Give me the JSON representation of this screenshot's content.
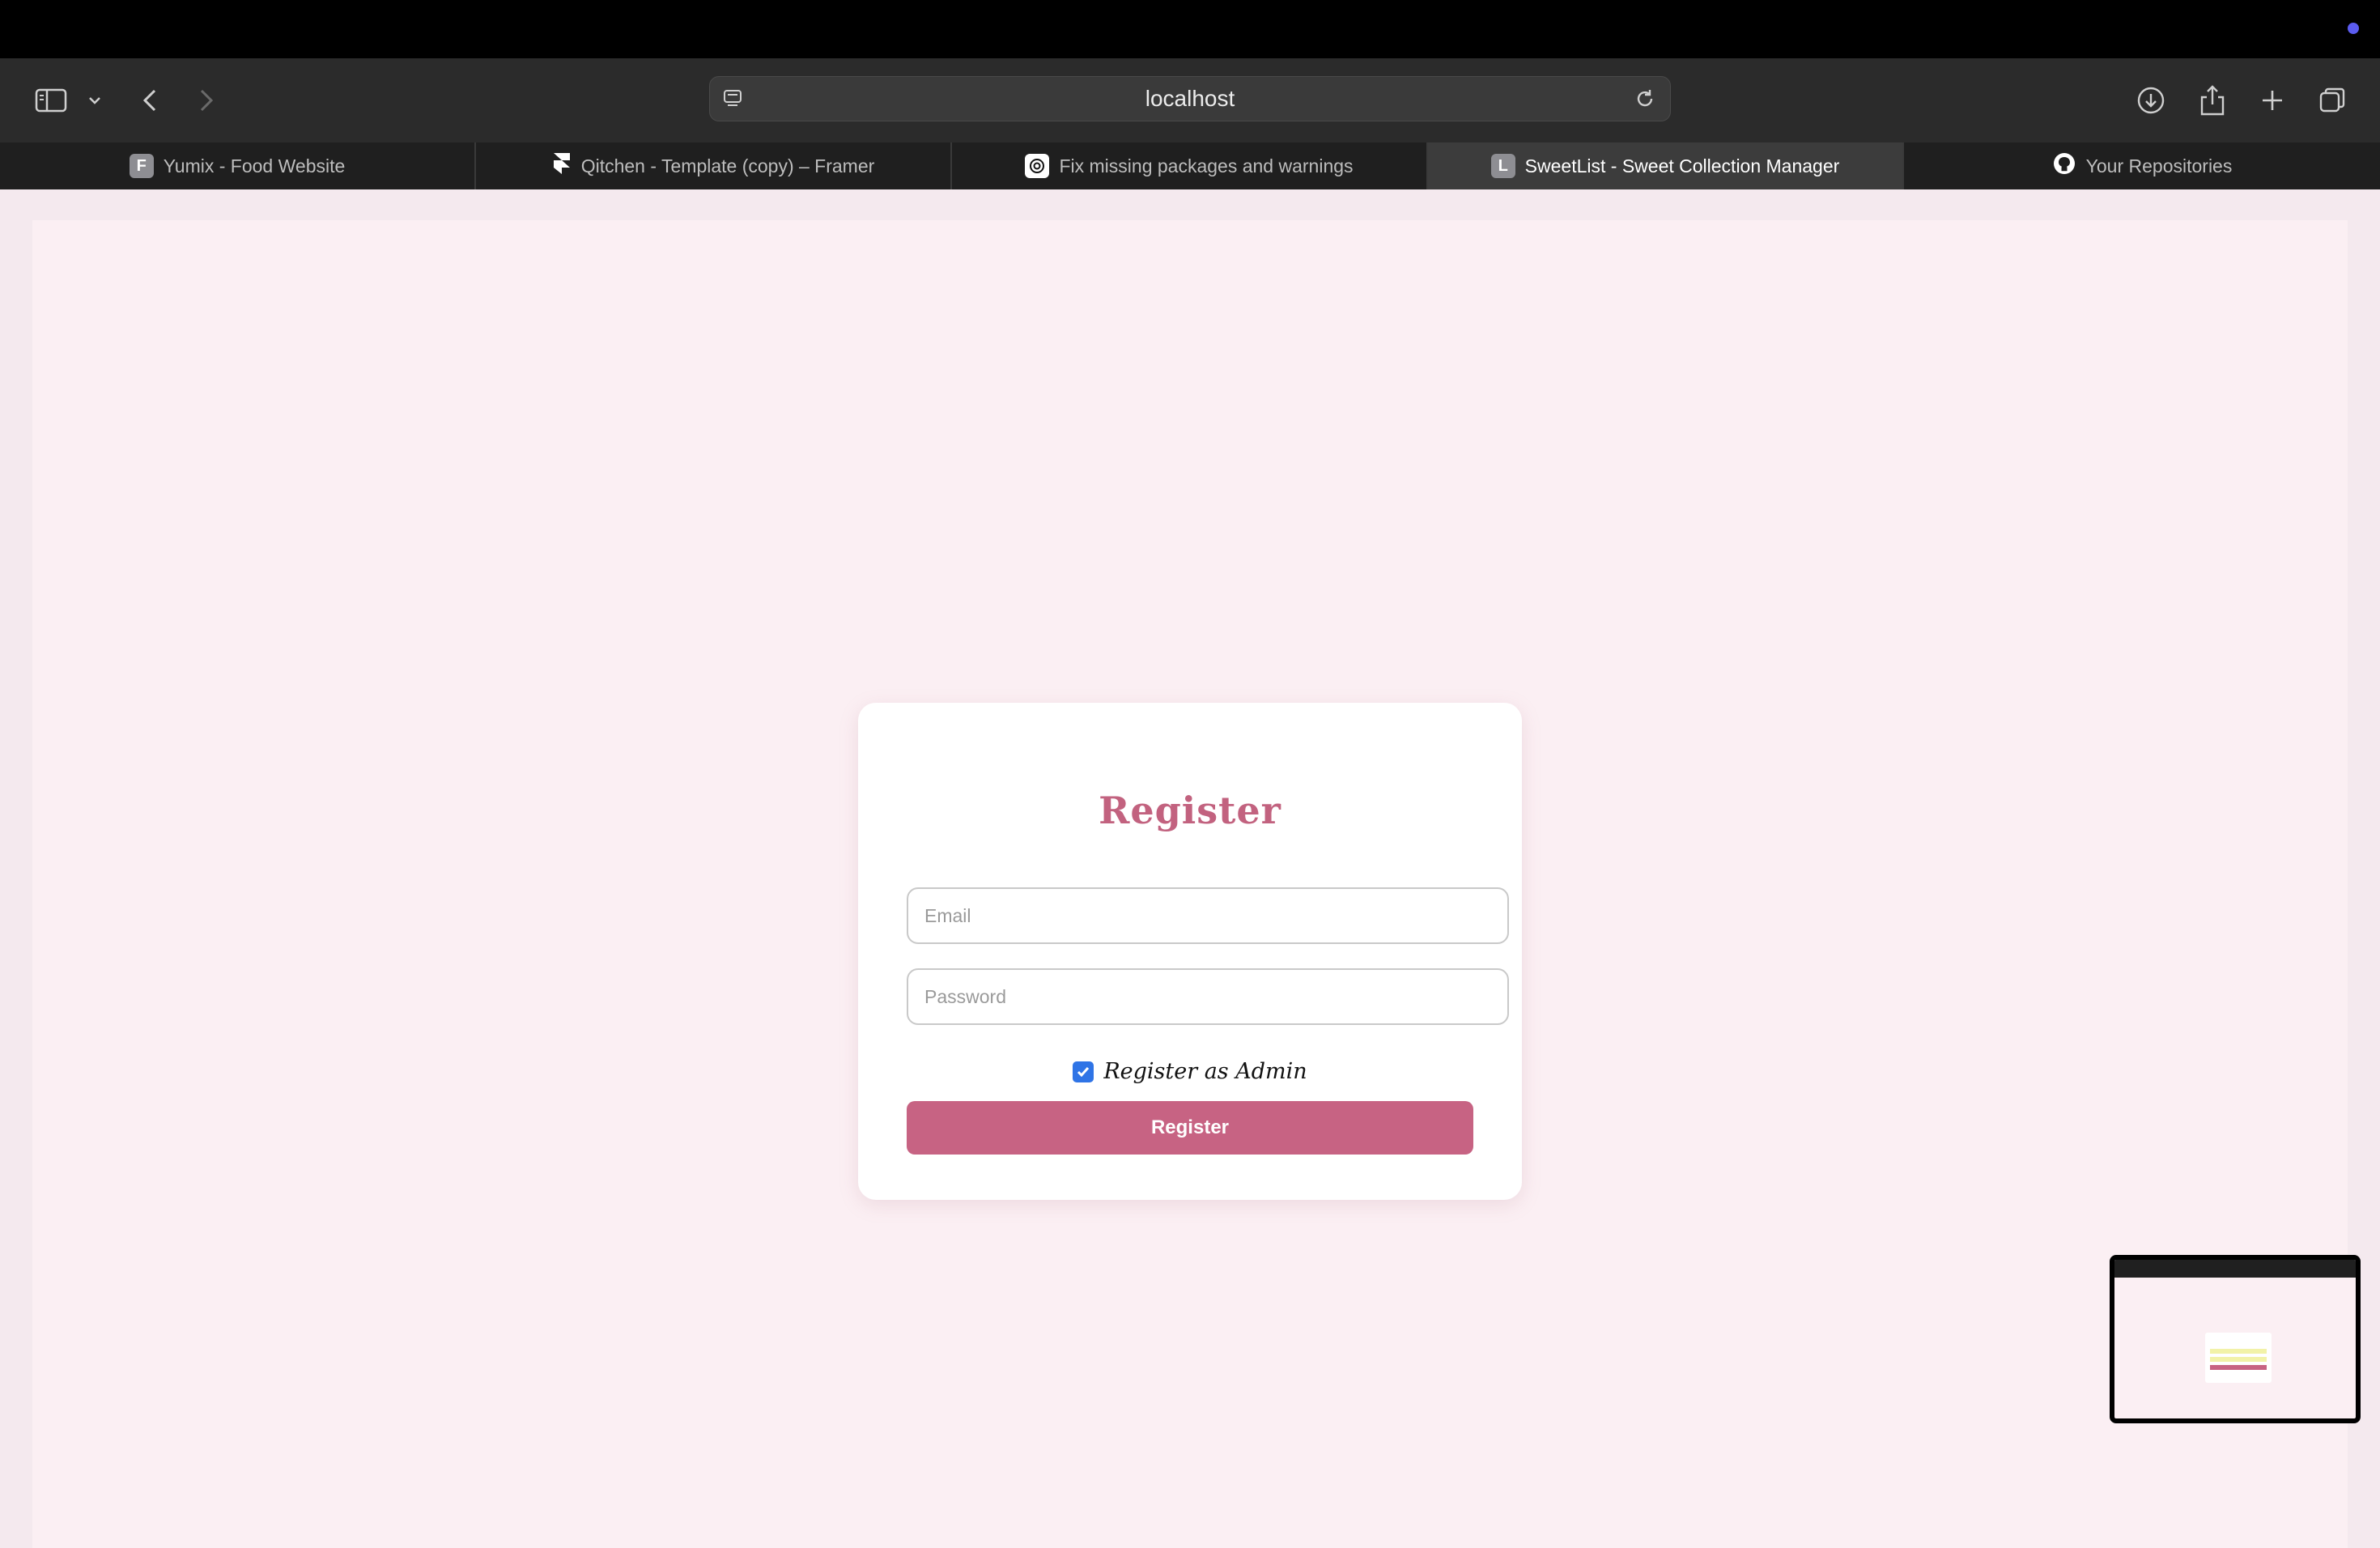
{
  "browser": {
    "address": "localhost",
    "tabs": [
      {
        "label": "Yumix - Food Website",
        "favicon": "F"
      },
      {
        "label": "Qitchen - Template (copy) – Framer",
        "favicon": "framer-icon"
      },
      {
        "label": "Fix missing packages and warnings",
        "favicon": "openai-icon"
      },
      {
        "label": "SweetList - Sweet Collection Manager",
        "favicon": "L"
      },
      {
        "label": "Your Repositories",
        "favicon": "github-icon"
      }
    ],
    "active_tab": 3
  },
  "form": {
    "title": "Register",
    "email_placeholder": "Email",
    "password_placeholder": "Password",
    "admin_checkbox_label": "Register as Admin",
    "admin_checked": true,
    "submit_label": "Register"
  },
  "colors": {
    "accent": "#c76383",
    "title": "#c2627f",
    "page_bg": "#fbeff3",
    "checkbox": "#2f74e6"
  }
}
